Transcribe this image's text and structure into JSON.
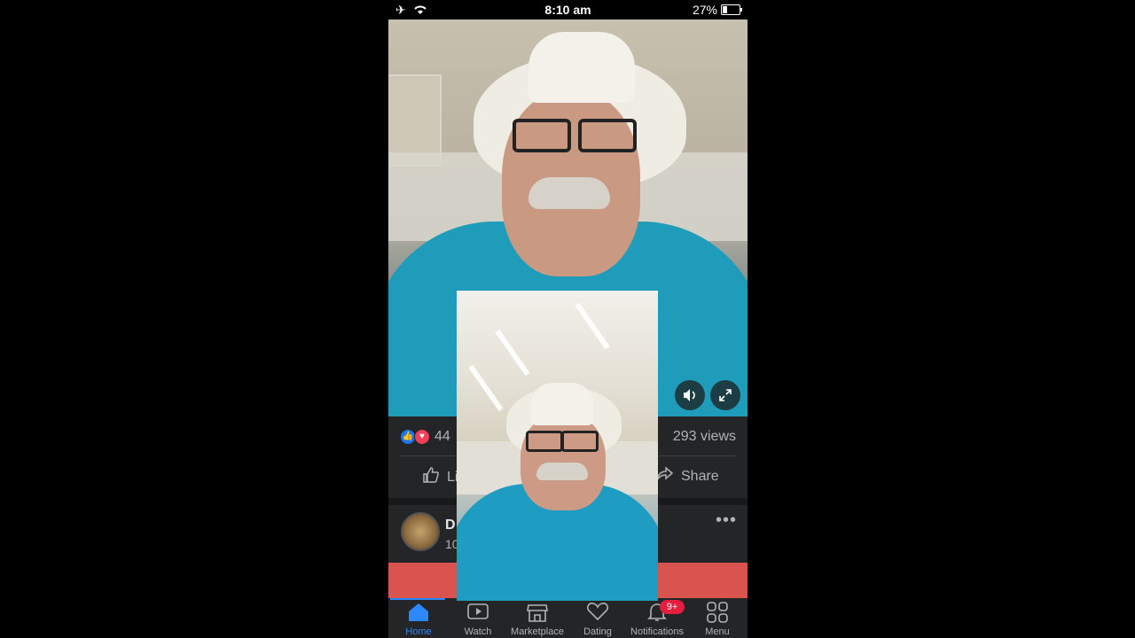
{
  "status_bar": {
    "time": "8:10 am",
    "battery_percent": "27%",
    "battery_level": 0.27,
    "icons": [
      "airplane-icon",
      "wifi-icon",
      "battery-icon"
    ]
  },
  "video": {
    "icons": [
      "volume-icon",
      "fullscreen-icon"
    ]
  },
  "reactions": {
    "count": "44",
    "views": "293 views",
    "icons": [
      "like-reaction-icon",
      "love-reaction-icon"
    ]
  },
  "actions": {
    "like_label": "Li",
    "share_label": "Share"
  },
  "next_post": {
    "name": "D",
    "time": "10",
    "more": "•••"
  },
  "bottom_nav": {
    "items": [
      {
        "label": "Home",
        "icon": "home-icon",
        "active": true
      },
      {
        "label": "Watch",
        "icon": "watch-icon"
      },
      {
        "label": "Marketplace",
        "icon": "marketplace-icon"
      },
      {
        "label": "Dating",
        "icon": "dating-icon"
      },
      {
        "label": "Notifications",
        "icon": "bell-icon",
        "badge": "9+"
      },
      {
        "label": "Menu",
        "icon": "menu-grid-icon"
      }
    ]
  },
  "colors": {
    "accent": "#2d88ff",
    "badge": "#e41e3f",
    "banner": "#d9534f"
  }
}
